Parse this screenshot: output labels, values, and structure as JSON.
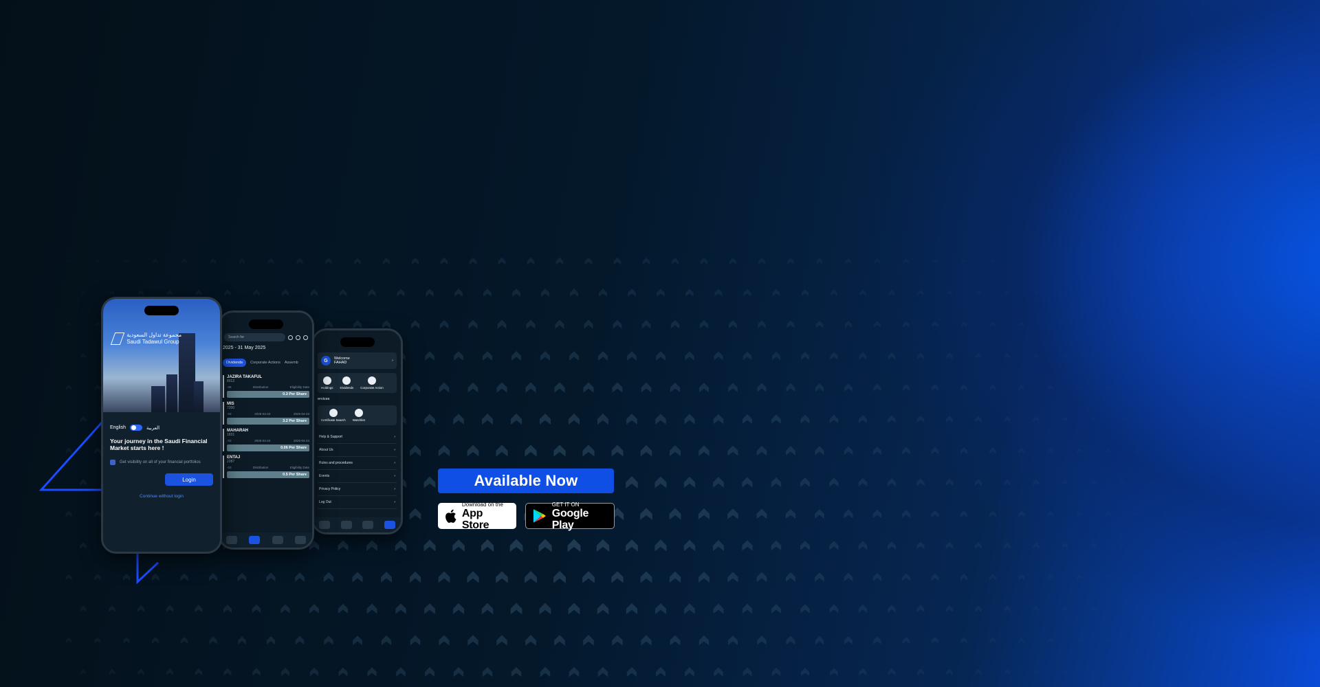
{
  "colors": {
    "accent": "#0f4fe6",
    "bg_dark": "#04141f",
    "bg_blue": "#0656e8"
  },
  "cta": {
    "label": "Available Now"
  },
  "stores": {
    "apple": {
      "small": "Download on the",
      "big": "App Store",
      "icon": "apple-icon"
    },
    "google": {
      "small": "GET IT ON",
      "big": "Google Play",
      "icon": "play-icon"
    }
  },
  "phone_login": {
    "logo_ar": "مجموعة تداول السعودية",
    "logo_en": "Saudi Tadawul Group",
    "lang_en": "English",
    "lang_ar": "العربية",
    "tagline": "Your journey in the Saudi Financial Market starts here !",
    "feature": "Get visibility on all of your financial portfolios",
    "login": "Login",
    "continue": "Continue without login"
  },
  "phone_calendar": {
    "search_placeholder": "Search for",
    "date_range": "2025 - 31 May 2025",
    "tabs": [
      "Dividends",
      "Corporate Actions",
      "Assemb"
    ],
    "meta_labels": [
      "Eligibility Date",
      "Distribution",
      "Eligibility Date"
    ],
    "cards": [
      {
        "name": "JAZIRA TAKAFUL",
        "code": "8012",
        "d1": "-08",
        "d2": "",
        "value": "0.3  Per Share"
      },
      {
        "name": "MIS",
        "code": "7200",
        "d1": "-03",
        "d2": "2025-04-23",
        "d3": "2025-04-23",
        "value": "3.2  Per Share"
      },
      {
        "name": "MAHARAH",
        "code": "1831",
        "d1": "-03",
        "d2": "2025-04-24",
        "d3": "2025-04-24",
        "value": "0.06  Per Share"
      },
      {
        "name": "ENTAJ",
        "code": "2287",
        "d1": "-03",
        "d2": "",
        "d3": "",
        "value": "0.5  Per Share"
      }
    ]
  },
  "phone_menu": {
    "avatar": "G",
    "welcome": "Welcome",
    "user": "FAHAD",
    "quick": [
      "Holdings",
      "Dividends",
      "Corporate Action"
    ],
    "services_title": "ervices",
    "services": [
      "Certificate Search",
      "Watchlist"
    ],
    "items": [
      "Help & Support",
      "About Us",
      "Rules and procedures",
      "Events",
      "Privacy Policy",
      "Log Out"
    ]
  }
}
